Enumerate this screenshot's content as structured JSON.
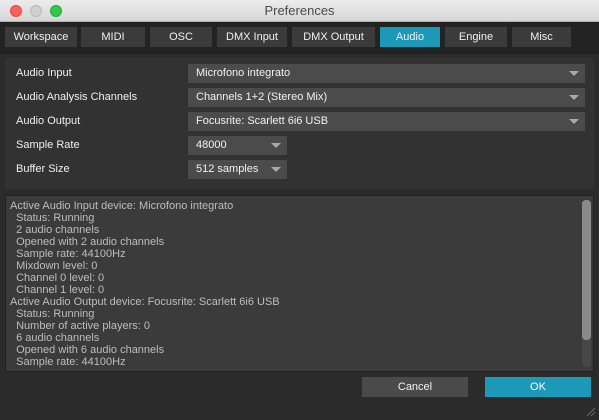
{
  "window": {
    "title": "Preferences"
  },
  "tabs": [
    {
      "label": "Workspace"
    },
    {
      "label": "MIDI"
    },
    {
      "label": "OSC"
    },
    {
      "label": "DMX Input"
    },
    {
      "label": "DMX Output"
    },
    {
      "label": "Audio"
    },
    {
      "label": "Engine"
    },
    {
      "label": "Misc"
    }
  ],
  "active_tab": "Audio",
  "audio": {
    "input_label": "Audio Input",
    "input_value": "Microfono integrato",
    "analysis_label": "Audio Analysis Channels",
    "analysis_value": "Channels 1+2 (Stereo Mix)",
    "output_label": "Audio Output",
    "output_value": "Focusrite: Scarlett 6i6 USB",
    "sample_rate_label": "Sample Rate",
    "sample_rate_value": "48000",
    "buffer_label": "Buffer Size",
    "buffer_value": "512 samples"
  },
  "log": [
    "Active Audio Input device: Microfono integrato",
    "  Status: Running",
    "  2 audio channels",
    "  Opened with 2 audio channels",
    "  Sample rate: 44100Hz",
    "  Mixdown level: 0",
    "  Channel 0 level: 0",
    "  Channel 1 level: 0",
    "Active Audio Output device: Focusrite: Scarlett 6i6 USB",
    "  Status: Running",
    "  Number of active players: 0",
    "  6 audio channels",
    "  Opened with 6 audio channels",
    "  Sample rate: 44100Hz"
  ],
  "buttons": {
    "cancel": "Cancel",
    "ok": "OK"
  },
  "colors": {
    "accent": "#1c98b8",
    "background": "#2b2b2b"
  }
}
